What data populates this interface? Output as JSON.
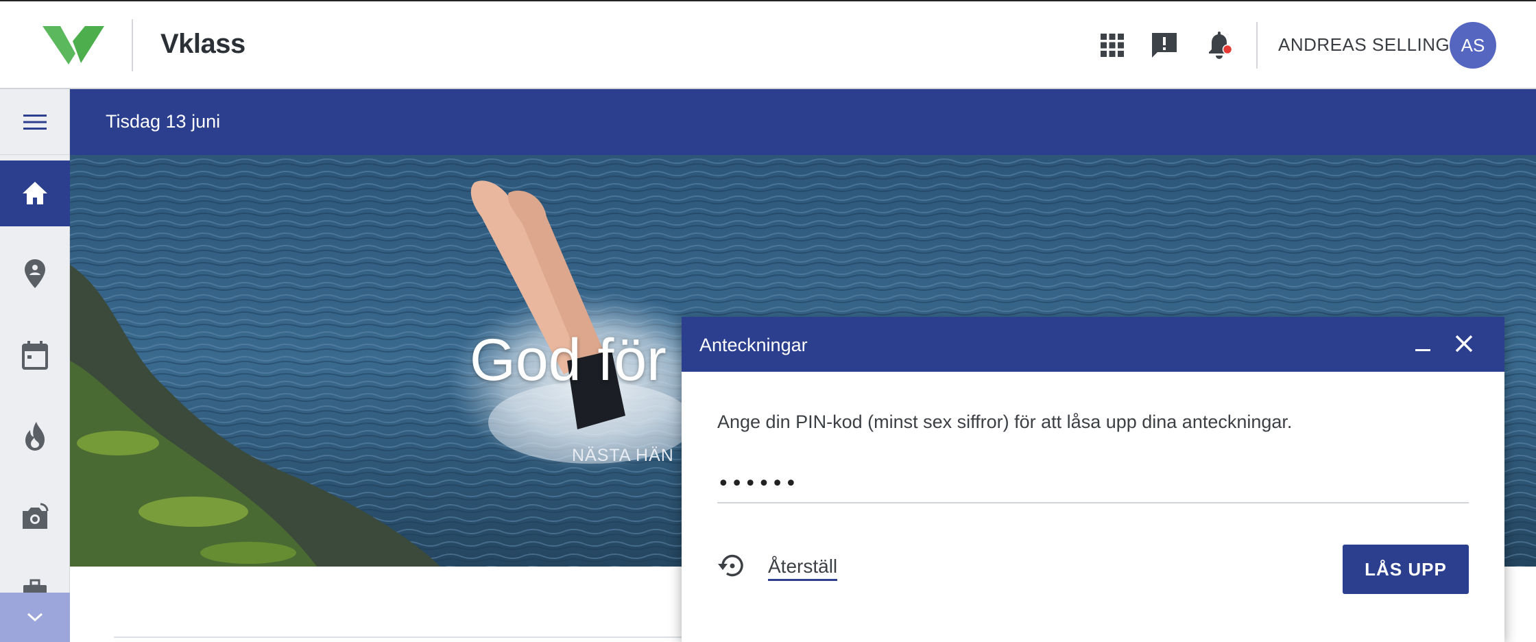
{
  "header": {
    "brand": "Vklass",
    "user_name": "ANDREAS SELLING",
    "avatar_initials": "AS",
    "icons": [
      "apps-grid-icon",
      "feedback-icon",
      "notifications-bell-icon"
    ],
    "notification_dot_color": "#e53935",
    "logo_color": "#5cb85c"
  },
  "sidebar": {
    "items": [
      {
        "icon": "menu-icon"
      },
      {
        "icon": "home-icon",
        "active": true
      },
      {
        "icon": "location-pin-icon"
      },
      {
        "icon": "calendar-icon"
      },
      {
        "icon": "flame-icon"
      },
      {
        "icon": "camera-icon"
      },
      {
        "icon": "briefcase-icon"
      }
    ],
    "expand_icon": "chevron-down-icon"
  },
  "datebar": {
    "date": "Tisdag 13 juni"
  },
  "hero": {
    "title": "God för",
    "subtitle": "NÄSTA HÄN"
  },
  "dialog": {
    "title": "Anteckningar",
    "message": "Ange din PIN-kod (minst sex siffror) för att låsa upp dina anteckningar.",
    "pin_value": "••••••",
    "reset_label": "Återställ",
    "unlock_label": "LÅS UPP"
  },
  "colors": {
    "primary": "#2c3f8f",
    "avatar": "#5566c0",
    "sidebar_bg": "#eceef1"
  }
}
